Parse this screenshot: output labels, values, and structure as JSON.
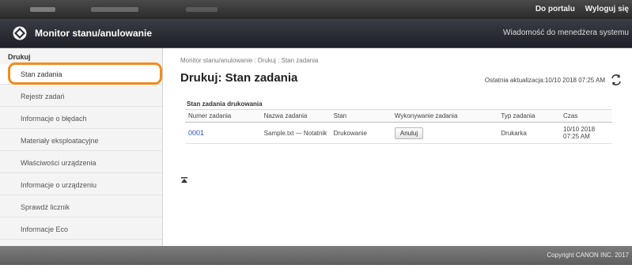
{
  "topbar": {
    "portal_link": "Do portalu",
    "logout_link": "Wyloguj się"
  },
  "header": {
    "app_title": "Monitor stanu/anulowanie",
    "messages_link": "Wiadomość do menedżera systemu"
  },
  "sidebar": {
    "group_label": "Drukuj",
    "items": [
      {
        "label": "Stan zadania",
        "active": true
      },
      {
        "label": "Rejestr zadań"
      },
      {
        "label": "Informacje o błędach"
      },
      {
        "label": "Materiały eksploatacyjne"
      },
      {
        "label": "Właściwości urządzenia"
      },
      {
        "label": "Informacje o urządzeniu"
      },
      {
        "label": "Sprawdź licznik"
      },
      {
        "label": "Informacje Eco"
      }
    ]
  },
  "main": {
    "breadcrumb": "Monitor stanu/anulowanie : Drukuj : Stan zadania",
    "page_title": "Drukuj: Stan zadania",
    "last_update": "Ostatnia aktualizacja:10/10 2018 07:25 AM",
    "section_title": "Stan zadania drukowania",
    "table": {
      "headers": [
        "Numer zadania",
        "Nazwa zadania",
        "Stan",
        "Wykonywanie zadania",
        "Typ zadania",
        "Czas"
      ],
      "rows": [
        {
          "number": "0001",
          "name": "Sample.txt — Notatnik",
          "status": "Drukowanie",
          "action": "Anuluj",
          "type": "Drukarka",
          "time": "10/10 2018 07:25 AM"
        }
      ]
    }
  },
  "footer": {
    "copyright": "Copyright CANON INC. 2017"
  },
  "colors": {
    "highlight": "#f08c1e",
    "link": "#2a55b8"
  }
}
